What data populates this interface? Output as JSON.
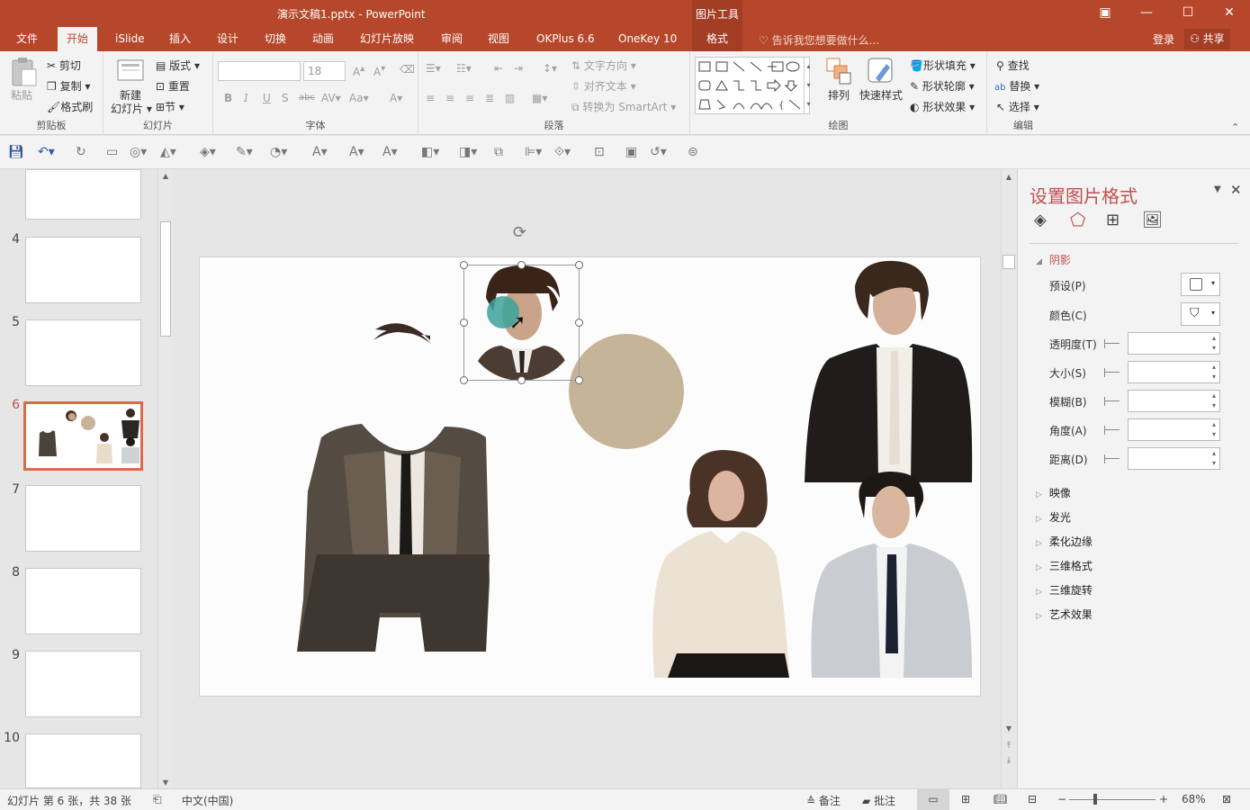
{
  "window": {
    "doc_title": "演示文稿1.pptx - PowerPoint",
    "context_group": "图片工具"
  },
  "tabs": [
    "文件",
    "开始",
    "iSlide",
    "插入",
    "设计",
    "切换",
    "动画",
    "幻灯片放映",
    "审阅",
    "视图",
    "OKPlus 6.6",
    "OneKey 10",
    "格式"
  ],
  "tellme": "告诉我您想要做什么...",
  "account": {
    "login": "登录",
    "share": "共享"
  },
  "ribbon": {
    "clipboard": {
      "paste": "粘贴",
      "cut": "剪切",
      "copy": "复制",
      "format_painter": "格式刷",
      "label": "剪贴板"
    },
    "slides": {
      "new_slide": "新建",
      "new_slide2": "幻灯片",
      "layout": "版式",
      "reset": "重置",
      "section": "节",
      "label": "幻灯片"
    },
    "font": {
      "size": "18",
      "label": "字体"
    },
    "paragraph": {
      "text_direction": "文字方向",
      "align_text": "对齐文本",
      "smartart": "转换为 SmartArt",
      "label": "段落"
    },
    "drawing": {
      "arrange": "排列",
      "quick_styles": "快速样式",
      "shape_fill": "形状填充",
      "shape_outline": "形状轮廓",
      "shape_effects": "形状效果",
      "label": "绘图"
    },
    "editing": {
      "find": "查找",
      "replace": "替换",
      "select": "选择",
      "label": "编辑"
    }
  },
  "thumbnails": [
    {
      "num": "4"
    },
    {
      "num": "5"
    },
    {
      "num": "6"
    },
    {
      "num": "7"
    },
    {
      "num": "8"
    },
    {
      "num": "9"
    },
    {
      "num": "10"
    }
  ],
  "format_pane": {
    "title": "设置图片格式",
    "shadow_section": "阴影",
    "preset": "预设(P)",
    "color": "颜色(C)",
    "transparency": "透明度(T)",
    "size": "大小(S)",
    "blur": "模糊(B)",
    "angle": "角度(A)",
    "distance": "距离(D)",
    "sections": [
      "映像",
      "发光",
      "柔化边缘",
      "三维格式",
      "三维旋转",
      "艺术效果"
    ]
  },
  "status": {
    "slide_info": "幻灯片 第 6 张，共 38 张",
    "language": "中文(中国)",
    "notes": "备注",
    "comments": "批注",
    "zoom": "68%"
  },
  "colors": {
    "accent": "#b7472a",
    "selection": "#d96a4a",
    "circle_tan": "#c6b499",
    "teal_dot": "#3aa39a"
  }
}
